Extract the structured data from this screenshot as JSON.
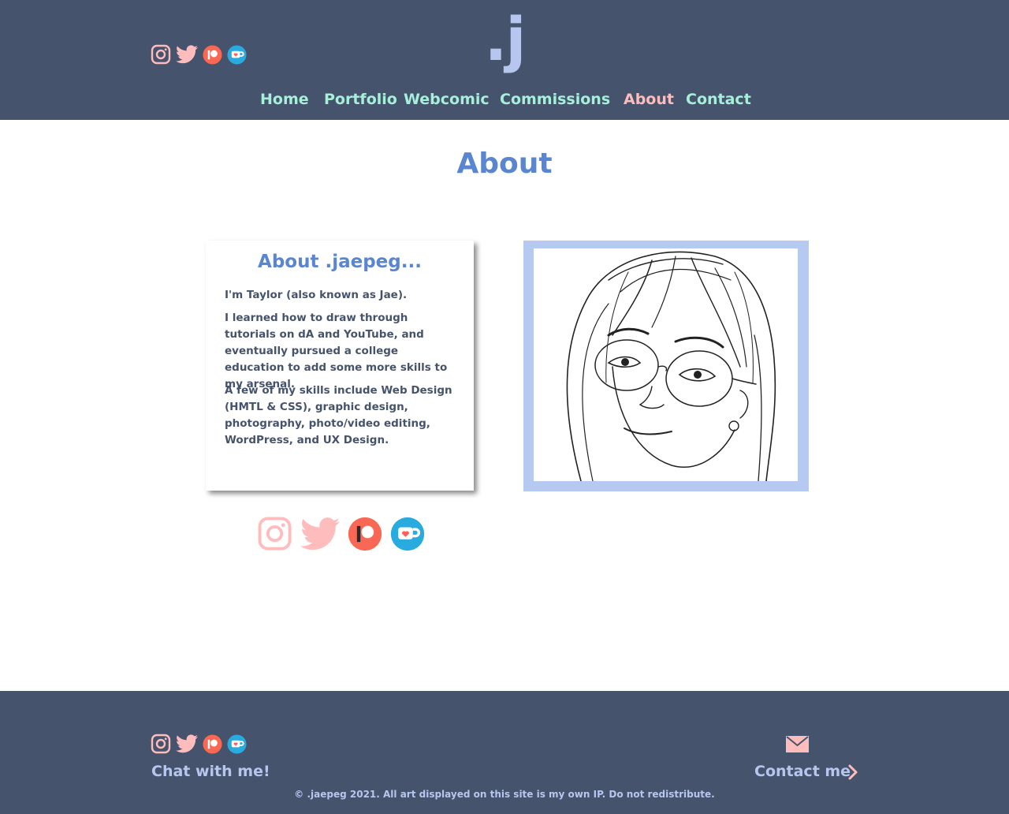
{
  "header": {
    "logo": ".j",
    "socials": [
      {
        "icon": "instagram-icon"
      },
      {
        "icon": "twitter-icon"
      },
      {
        "icon": "patreon-icon"
      },
      {
        "icon": "kofi-icon"
      }
    ],
    "nav": [
      {
        "label": "Home"
      },
      {
        "label": "Portfolio"
      },
      {
        "label": "Webcomic"
      },
      {
        "label": "Commissions"
      },
      {
        "label": "About",
        "active": true
      },
      {
        "label": "Contact"
      }
    ]
  },
  "main": {
    "title": "About",
    "card": {
      "heading": "About .jaepeg...",
      "paragraphs": [
        "I'm Taylor (also known as Jae).",
        "I learned how to draw through tutorials on dA and YouTube, and eventually pursued a college education to add some more skills to my arsenal.",
        "A few of my skills include Web Design (HMTL & CSS), graphic design, photography, photo/video editing, WordPress, and UX Design."
      ]
    }
  },
  "footer": {
    "chat_label": "Chat with me!",
    "contact_label": "Contact me",
    "copyright": "© .jaepeg 2021. All art displayed on this site is my own IP. Do not redistribute."
  },
  "colors": {
    "header_bg": "#46536c",
    "nav_text": "#a6f0da",
    "nav_active": "#ffbcbc",
    "accent_blue": "#5a85d0",
    "light_blue": "#b6c6ee",
    "pink": "#ffbcbc",
    "patreon": "#f96854",
    "kofi": "#29abe0"
  }
}
